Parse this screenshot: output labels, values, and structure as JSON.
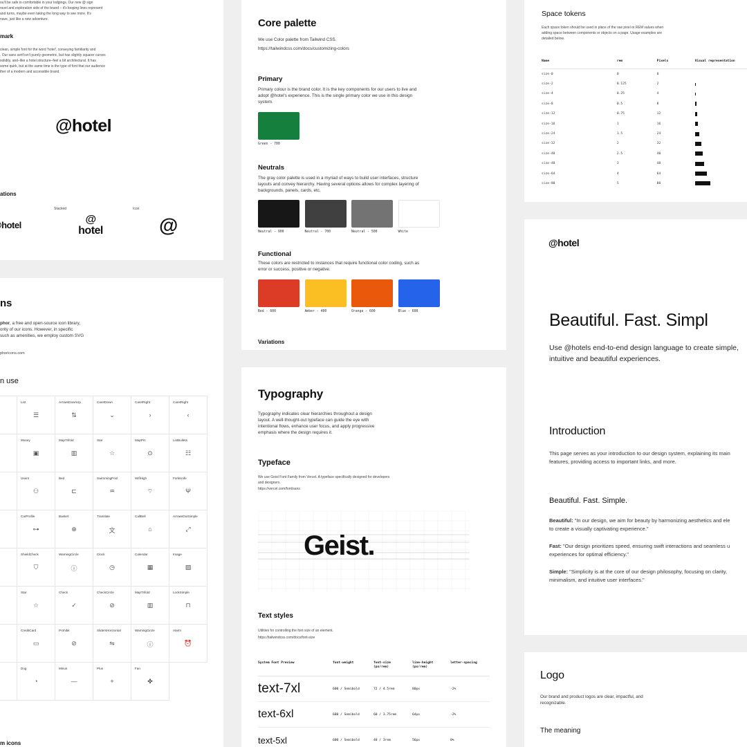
{
  "brand": {
    "logo": "@hotel",
    "logo_stacked_top": "@",
    "logo_stacked_bottom": "hotel",
    "logo_icon": "@"
  },
  "card_logo_meaning": {
    "intro_lines": [
      "ou'll be safe in comfortable in your lodgings. Our new @ sign",
      "ravel and exploration side of the brand – it's looping lines represent",
      "and turns, maybe even taking the long way to see more. It's",
      "nave, just like a new adventure."
    ],
    "wordmark_heading": "mark",
    "wordmark_lines": [
      "clean, simple font for the word 'hotel', conveying familiarity and",
      ". Our sans serif isn't purely geometric, but has slightly squarer curves",
      "solidity, and–like a hotel structure–feel a bit architectural. It has",
      "some quirk, but at the same time is the type of font that our audience",
      "ther of a modern and accessible brand."
    ],
    "variations_heading": "ations",
    "stacked_label": "Stacked",
    "icon_label": "Icon"
  },
  "card_icons": {
    "title": "ns",
    "desc_bold": "phor",
    "desc_lines": [
      ", a free and open-source icon library,",
      "ority of our icons. However, in specific",
      "such as amenities, we employ custom SVG"
    ],
    "link": "phoricons.com",
    "in_use_heading": "n use",
    "rows": [
      [
        {
          "name": "lass",
          "glyph": ""
        },
        {
          "name": "List",
          "glyph": "☰"
        },
        {
          "name": "ArrowsDownUp",
          "glyph": "⇅"
        },
        {
          "name": "CaretDown",
          "glyph": "⌄"
        },
        {
          "name": "CaretRight",
          "glyph": "›"
        },
        {
          "name": "CaretRight",
          "glyph": "‹"
        }
      ],
      [
        {
          "name": "",
          "glyph": ""
        },
        {
          "name": "Money",
          "glyph": "▣"
        },
        {
          "name": "MapTrifold",
          "glyph": "▥"
        },
        {
          "name": "Star",
          "glyph": "☆"
        },
        {
          "name": "MapPin",
          "glyph": "⊙"
        },
        {
          "name": "ListBullets",
          "glyph": "☷"
        }
      ],
      [
        {
          "name": "",
          "glyph": ""
        },
        {
          "name": "Users",
          "glyph": "⚇"
        },
        {
          "name": "Bed",
          "glyph": "⊏"
        },
        {
          "name": "SwimmingPool",
          "glyph": "♒"
        },
        {
          "name": "WifiHigh",
          "glyph": "⌔"
        },
        {
          "name": "ForkKnife",
          "glyph": "Ψ"
        }
      ],
      [
        {
          "name": "",
          "glyph": ""
        },
        {
          "name": "CarProfile",
          "glyph": "⊶"
        },
        {
          "name": "Basket",
          "glyph": "⊕"
        },
        {
          "name": "Translate",
          "glyph": "文"
        },
        {
          "name": "CallBell",
          "glyph": "⌂"
        },
        {
          "name": "ArrowsOutSimple",
          "glyph": "⤢"
        }
      ],
      [
        {
          "name": "",
          "glyph": ""
        },
        {
          "name": "ShieldCheck",
          "glyph": "⛉"
        },
        {
          "name": "WarningCircle",
          "glyph": "ⓘ"
        },
        {
          "name": "Clock",
          "glyph": "◷"
        },
        {
          "name": "Calendar",
          "glyph": "▦"
        },
        {
          "name": "Image",
          "glyph": "▨"
        }
      ],
      [
        {
          "name": "",
          "glyph": ""
        },
        {
          "name": "Star",
          "glyph": "☆"
        },
        {
          "name": "Check",
          "glyph": "✓"
        },
        {
          "name": "CheckCircle",
          "glyph": "⊘"
        },
        {
          "name": "MapTrifold",
          "glyph": "▥"
        },
        {
          "name": "LockSimple",
          "glyph": "⊓"
        }
      ],
      [
        {
          "name": "",
          "glyph": ""
        },
        {
          "name": "CreditCard",
          "glyph": "▭"
        },
        {
          "name": "Prohibit",
          "glyph": "⊘"
        },
        {
          "name": "SlidersHorizontal",
          "glyph": "⇋"
        },
        {
          "name": "WarningCircle",
          "glyph": "ⓘ"
        },
        {
          "name": "Alarm",
          "glyph": "⏰"
        }
      ],
      [
        {
          "name": "ots",
          "glyph": ""
        },
        {
          "name": "Dog",
          "glyph": "◔"
        },
        {
          "name": "Minus",
          "glyph": "—"
        },
        {
          "name": "Plus",
          "glyph": "+"
        },
        {
          "name": "Fan",
          "glyph": "✤"
        },
        {
          "name": "",
          "glyph": ""
        }
      ]
    ],
    "footer_heading": "m icons"
  },
  "card_palette": {
    "title": "Core palette",
    "intro": "We use Color palette from Tailwind CSS.",
    "link": "https://tailwindcss.com/docs/customizing-colors",
    "primary_heading": "Primary",
    "primary_lines": [
      "Primary colour is the brand color. It is the key components for our users to live and",
      "adopt @hotel's experience. This is the single primary color we use in this design",
      "system."
    ],
    "primary_swatch": {
      "label": "Green - 700",
      "color": "#15803d"
    },
    "neutrals_heading": "Neutrals",
    "neutrals_lines": [
      "The gray color palette is used in a myriad of ways to build user interfaces, structure",
      "layouts and convey hierarchy. Having several options allows for complex layering of",
      "backgrounds, panels, cards, etc."
    ],
    "neutrals": [
      {
        "label": "Neutral - 900",
        "color": "#171717"
      },
      {
        "label": "Neutral - 700",
        "color": "#404040"
      },
      {
        "label": "Neutral - 500",
        "color": "#737373"
      },
      {
        "label": "White",
        "color": "#ffffff"
      }
    ],
    "functional_heading": "Functional",
    "functional_lines": [
      "These colors are restricted to instances that require functional color coding, such as",
      "error or success, positive or negative."
    ],
    "functional": [
      {
        "label": "Red - 600",
        "color": "#dc3b26"
      },
      {
        "label": "Amber - 400",
        "color": "#fbbf24"
      },
      {
        "label": "Orange - 600",
        "color": "#ea580c"
      },
      {
        "label": "Blue - 600",
        "color": "#2563eb"
      }
    ],
    "variations_heading": "Variations"
  },
  "card_typography": {
    "title": "Typography",
    "lines": [
      "Typography indicates clear hierarchies throughout a design",
      "layout. A well-thought-out typeface can guide the eye with",
      "intentional flows, enhance user focus, and apply progressive",
      "emphasis where the design requires it."
    ],
    "typeface_heading": "Typeface",
    "typeface_lines": [
      "We use Geist Font Family from Vercel. A typeface specifically designed for developers",
      "and designers."
    ],
    "typeface_link": "https://vercel.com/font/sans",
    "specimen": "Geist.",
    "text_styles_heading": "Text styles",
    "text_styles_desc": "Utilities for controlling the font size of an element.",
    "text_styles_link": "https://tailwindcss.com/docs/font-size",
    "columns": [
      "System Font Preview",
      "font-weight",
      "font-size\n(px/rem)",
      "line-height\n(px/rem)",
      "letter-spacing"
    ],
    "rows": [
      {
        "preview": "text-7xl",
        "weight": "600 / Semibold",
        "size": "72 / 4.5rem",
        "lh": "80px",
        "ls": "-2%"
      },
      {
        "preview": "text-6xl",
        "weight": "600 / Semibold",
        "size": "60 / 3.75rem",
        "lh": "64px",
        "ls": "-2%"
      },
      {
        "preview": "text-5xl",
        "weight": "600 / Semibold",
        "size": "48 / 3rem",
        "lh": "56px",
        "ls": "0%"
      }
    ]
  },
  "card_space": {
    "title": "Space tokens",
    "desc_lines": [
      "Each space token should be used in place of the raw pixel or REM values when",
      "adding space between components or objects on a page. Usage examples are",
      "detailed below."
    ],
    "columns": [
      "Name",
      "rem",
      "Pixels",
      "Visual representation"
    ],
    "rows": [
      {
        "name": "size-0",
        "rem": "0",
        "px": "0",
        "bar": 0
      },
      {
        "name": "size-2",
        "rem": "0.125",
        "px": "2",
        "bar": 2
      },
      {
        "name": "size-4",
        "rem": "0.25",
        "px": "4",
        "bar": 4
      },
      {
        "name": "size-8",
        "rem": "0.5",
        "px": "8",
        "bar": 8
      },
      {
        "name": "size-12",
        "rem": "0.75",
        "px": "12",
        "bar": 12
      },
      {
        "name": "size-16",
        "rem": "1",
        "px": "16",
        "bar": 16
      },
      {
        "name": "size-24",
        "rem": "1.5",
        "px": "24",
        "bar": 24
      },
      {
        "name": "size-32",
        "rem": "2",
        "px": "32",
        "bar": 32
      },
      {
        "name": "size-40",
        "rem": "2.5",
        "px": "40",
        "bar": 40
      },
      {
        "name": "size-48",
        "rem": "3",
        "px": "48",
        "bar": 48
      },
      {
        "name": "size-64",
        "rem": "4",
        "px": "64",
        "bar": 64
      },
      {
        "name": "size-80",
        "rem": "5",
        "px": "80",
        "bar": 80
      }
    ]
  },
  "card_intro": {
    "logo": "@hotel",
    "hero": "Beautiful. Fast. Simpl",
    "hero_sub_lines": [
      "Use @hotels end-to-end design language to create simple,",
      "intuitive and beautiful experiences."
    ],
    "intro_heading": "Introduction",
    "intro_lines": [
      "This page serves as your introduction to our design system, explaining its main",
      "features, providing access to important links, and more."
    ],
    "bfs_heading": "Beautiful. Fast. Simple.",
    "beautiful_label": "Beautiful:",
    "beautiful_lines": [
      " \"In our design, we aim for beauty by harmonizing aesthetics and ele",
      "to create a visually captivating experience.\""
    ],
    "fast_label": "Fast:",
    "fast_lines": [
      " \"Our design prioritizes speed, ensuring swift interactions and seamless u",
      "experiences for optimal efficiency.\""
    ],
    "simple_label": "Simple:",
    "simple_lines": [
      " \"Simplicity is at the core of our design philosophy, focusing on clarity,",
      "minimalism, and intuitive user interfaces.\""
    ]
  },
  "card_logo": {
    "title": "Logo",
    "lines": [
      "Our brand and product logos are clear, impactful, and",
      "recognizable."
    ],
    "meaning_heading": "The meaning"
  }
}
